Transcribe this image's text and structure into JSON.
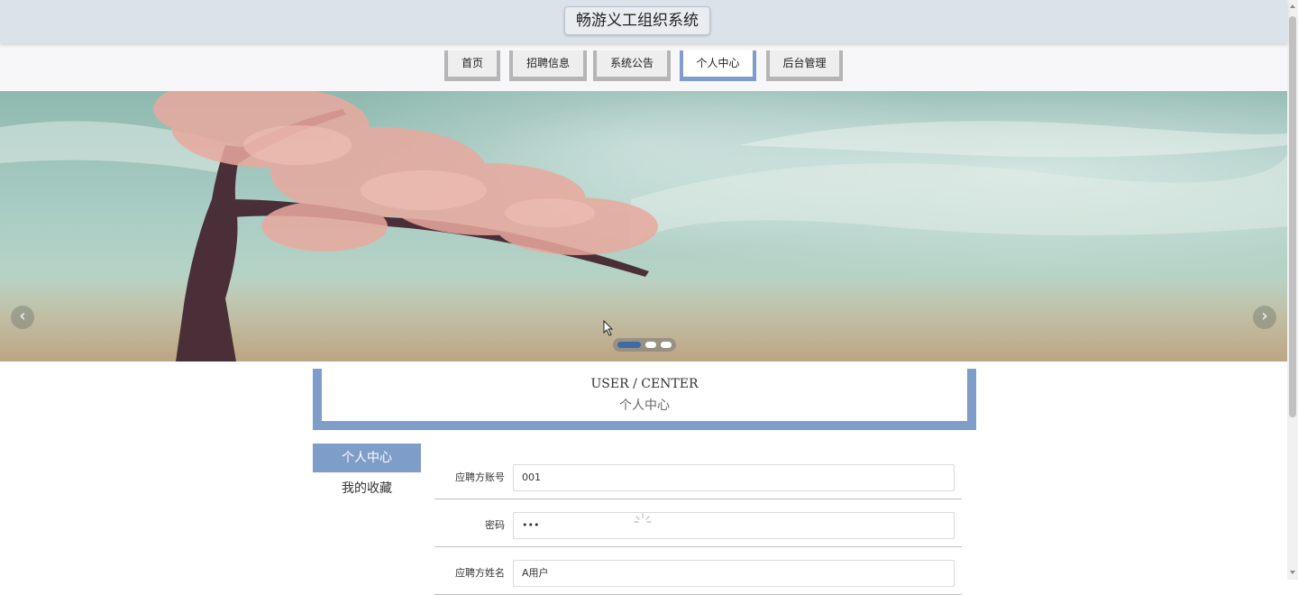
{
  "header": {
    "title": "畅游义工组织系统"
  },
  "nav": {
    "items": [
      {
        "label": "首页"
      },
      {
        "label": "招聘信息"
      },
      {
        "label": "系统公告"
      },
      {
        "label": "个人中心"
      },
      {
        "label": "后台管理"
      }
    ],
    "active_index": 3
  },
  "banner": {
    "prev_icon": "chevron-left-icon",
    "next_icon": "chevron-right-icon",
    "prev_glyph": "‹",
    "next_glyph": "›",
    "slide_count": 3,
    "active_slide": 1
  },
  "center": {
    "title_en": "USER / CENTER",
    "title_cn": "个人中心"
  },
  "side_menu": {
    "items": [
      {
        "label": "个人中心"
      },
      {
        "label": "我的收藏"
      }
    ],
    "active_index": 0
  },
  "form": {
    "fields": [
      {
        "label": "应聘方账号",
        "value": "001"
      },
      {
        "label": "密码",
        "value": "•••"
      },
      {
        "label": "应聘方姓名",
        "value": "A用户"
      }
    ]
  },
  "colors": {
    "accent": "#7e9dc8",
    "header_bg": "#dce2ea",
    "nav_bg": "#f7f6f9",
    "nav_inactive_border": "#b5b5b5"
  }
}
